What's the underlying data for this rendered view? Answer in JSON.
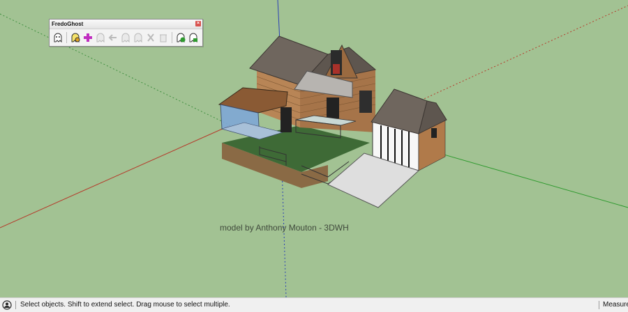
{
  "toolbar": {
    "title": "FredoGhost",
    "close_glyph": "×",
    "buttons": [
      {
        "icon": "ghost-toggle-icon",
        "enabled": true
      },
      {
        "icon": "ghost-settings-icon",
        "enabled": true
      },
      {
        "icon": "ghost-add-icon",
        "enabled": true
      },
      {
        "icon": "ghost-pick-icon",
        "enabled": false
      },
      {
        "icon": "ghost-back-icon",
        "enabled": false
      },
      {
        "icon": "ghost-cycle-icon",
        "enabled": false
      },
      {
        "icon": "ghost-reset-icon",
        "enabled": false
      },
      {
        "icon": "ghost-cut-icon",
        "enabled": false
      },
      {
        "icon": "ghost-erase-icon",
        "enabled": false
      },
      {
        "icon": "ghost-check-icon",
        "enabled": true
      },
      {
        "icon": "ghost-house-icon",
        "enabled": true
      }
    ]
  },
  "viewport": {
    "watermark": "model by Anthony Mouton - 3DWH",
    "background_color": "#a2c293"
  },
  "statusbar": {
    "message": "Select objects. Shift to extend select. Drag mouse to select multiple.",
    "measurements_label": "Measure"
  }
}
